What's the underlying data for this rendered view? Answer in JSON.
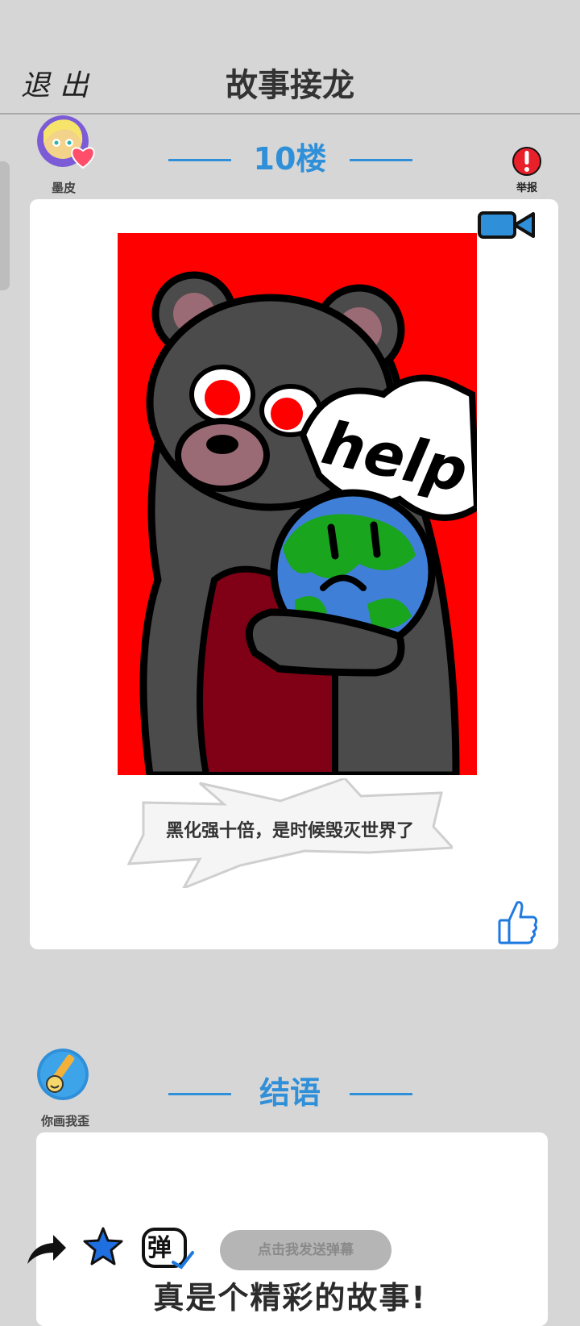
{
  "header": {
    "exit_label": "退出",
    "title": "故事接龙"
  },
  "floor_post": {
    "author_name": "墨皮",
    "floor_label": "10楼",
    "report_label": "举报",
    "caption": "黑化强十倍，是时候毁灭世界了",
    "drawing_text": "help"
  },
  "ending_post": {
    "author_name": "你画我歪",
    "section_label": "结语",
    "text": "真是个精彩的故事!"
  },
  "bottom_bar": {
    "danmaku_placeholder": "点击我发送弹幕",
    "danmaku_icon_char": "弹"
  },
  "icons": {
    "video": "video-camera-icon",
    "report": "exclamation-icon",
    "like": "thumbs-up-icon",
    "share": "share-arrow-icon",
    "favorite": "star-icon",
    "danmaku": "danmaku-toggle-icon"
  },
  "colors": {
    "accent": "#2f8fd8",
    "background": "#d6d6d6",
    "report_red": "#e8202a",
    "drawing_bg": "#ff0000"
  }
}
